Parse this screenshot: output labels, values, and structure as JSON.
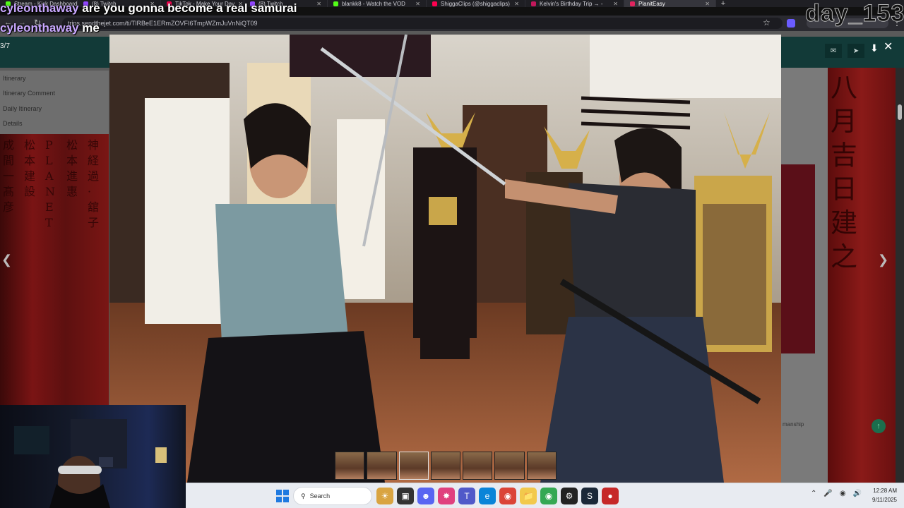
{
  "browser": {
    "tabs": [
      {
        "label": "Stream - Kick Dashboard",
        "color": "#53fc18",
        "active": false
      },
      {
        "label": "(8) Twitch",
        "color": "#9146ff",
        "active": false
      },
      {
        "label": "TikTok - Make Your Day",
        "color": "#ff0050",
        "active": false
      },
      {
        "label": "(8) Twitch",
        "color": "#9146ff",
        "active": false
      },
      {
        "label": "blankk8 - Watch the VOD",
        "color": "#53fc18",
        "active": false
      },
      {
        "label": "ShiggaClips (@shiggaclips)",
        "color": "#ff0050",
        "active": false
      },
      {
        "label": "Kelvin's Birthday Trip → -",
        "color": "#c2185b",
        "active": false
      },
      {
        "label": "PlanitEasy",
        "color": "#e0245e",
        "active": true
      }
    ],
    "url": "trips.sendthejet.com/ti/TlRBeE1ERmZOVFI6TmpWZmJuVnNiQT09"
  },
  "chat": [
    {
      "user": "cyleonthaway",
      "message": "are you gonna become a real samurai"
    },
    {
      "user": "cyleonthaway",
      "message": "me"
    }
  ],
  "overlay": {
    "day_counter": "day_153"
  },
  "viewer": {
    "counter": "3/7",
    "download_icon": "download-icon",
    "close_icon": "close-icon",
    "prev_icon": "chevron-left-icon",
    "next_icon": "chevron-right-icon",
    "thumbnail_count": 7,
    "active_thumbnail": 3
  },
  "page": {
    "sidebar_items": [
      "Itinerary",
      "Itinerary Comment",
      "Daily Itinerary",
      "Details"
    ],
    "banner_left_columns": [
      "成間一髙彦",
      "松本建設",
      "PLANET",
      "松本進惠",
      "神経過·舘子"
    ],
    "banner_right_text": "八月吉日建之",
    "footer_snippet": "manship"
  },
  "taskbar": {
    "search_label": "Search",
    "time": "12:28 AM",
    "date": "9/11/2025"
  }
}
